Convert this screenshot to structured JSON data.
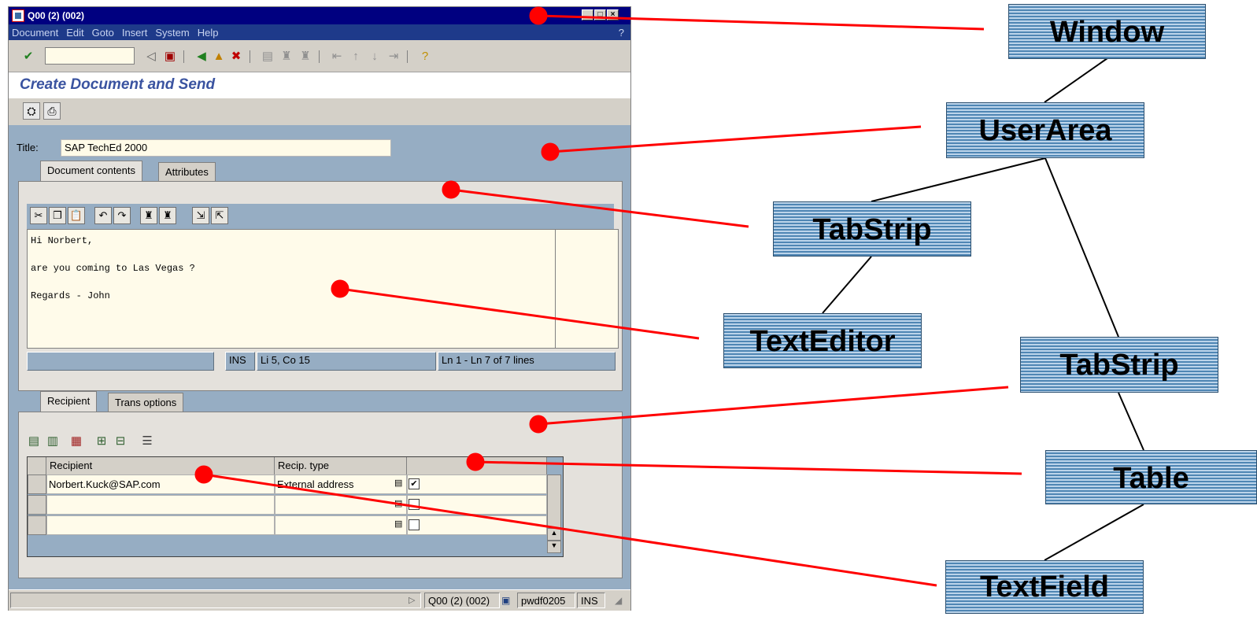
{
  "window": {
    "title": "Q00 (2) (002)",
    "menu": [
      "Document",
      "Edit",
      "Goto",
      "Insert",
      "System",
      "Help"
    ],
    "help_mark": "?"
  },
  "page_title": "Create Document and Send",
  "form": {
    "title_label": "Title:",
    "title_value": "SAP TechEd 2000"
  },
  "tabs_top": [
    "Document contents",
    "Attributes"
  ],
  "editor": {
    "lines": [
      "Hi Norbert,",
      "are you coming to Las Vegas ?",
      "Regards - John"
    ],
    "status_mode": "INS",
    "status_pos": "Li 5, Co 15",
    "status_lines": "Ln 1 - Ln 7 of 7 lines"
  },
  "tabs_bottom": [
    "Recipient",
    "Trans options"
  ],
  "table": {
    "columns": [
      "Recipient",
      "Recip. type"
    ],
    "rows": [
      {
        "recipient": "Norbert.Kuck@SAP.com",
        "type": "External address",
        "checked": true
      },
      {
        "recipient": "",
        "type": "",
        "checked": false
      },
      {
        "recipient": "",
        "type": "",
        "checked": false
      }
    ]
  },
  "statusbar": {
    "system": "Q00 (2) (002)",
    "server": "pwdf0205",
    "mode": "INS"
  },
  "diagram": {
    "nodes": [
      "Window",
      "UserArea",
      "TabStrip",
      "TextEditor",
      "TabStrip",
      "Table",
      "TextField"
    ],
    "colors": {
      "pointer": "#ff0000",
      "node_fill_light": "#bcd4ea",
      "node_fill_dark": "#4f86b4"
    }
  }
}
